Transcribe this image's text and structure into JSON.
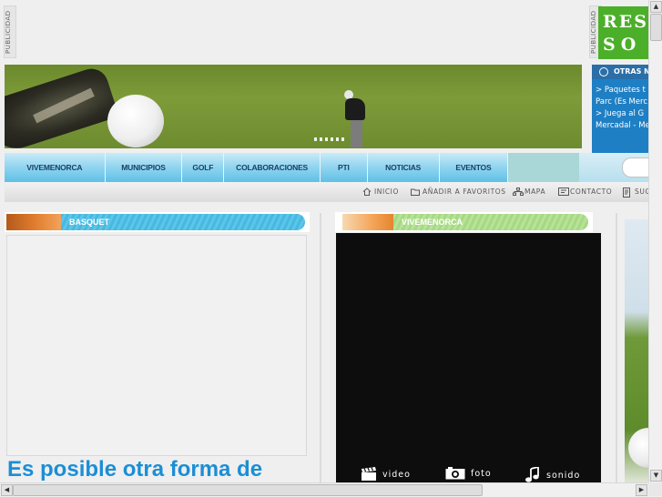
{
  "ads": {
    "left_label": "PUBLICIDAD",
    "right_label": "PUBLICIDAD",
    "promo_line1": "RES",
    "promo_line2": "SO"
  },
  "side_box": {
    "title": "OTRAS N",
    "links": [
      "> Paquetes t",
      "Parc (Es Merc",
      "> Juega al G",
      "Mercadal - Me"
    ]
  },
  "nav": {
    "items": [
      "VIVEMENORCA",
      "MUNICIPIOS",
      "GOLF",
      "COLABORACIONES",
      "PTI",
      "NOTICIAS",
      "EVENTOS"
    ]
  },
  "utility": {
    "inicio": "INICIO",
    "favoritos": "AÑADIR A FAVORITOS",
    "mapa": "MAPA",
    "contacto": "CONTACTO",
    "sug": "SUG"
  },
  "sections": {
    "basquet": "BASQUET",
    "vivemenorca": "VIVEMENORCA"
  },
  "media": {
    "video": "video",
    "foto": "foto",
    "sonido": "sonido"
  },
  "headline": "Es posible otra forma de",
  "colors": {
    "nav_text": "#1a3f64",
    "headline": "#1b8ed6",
    "promo_green": "#4caf2a",
    "side_box": "#1f7fc4"
  }
}
